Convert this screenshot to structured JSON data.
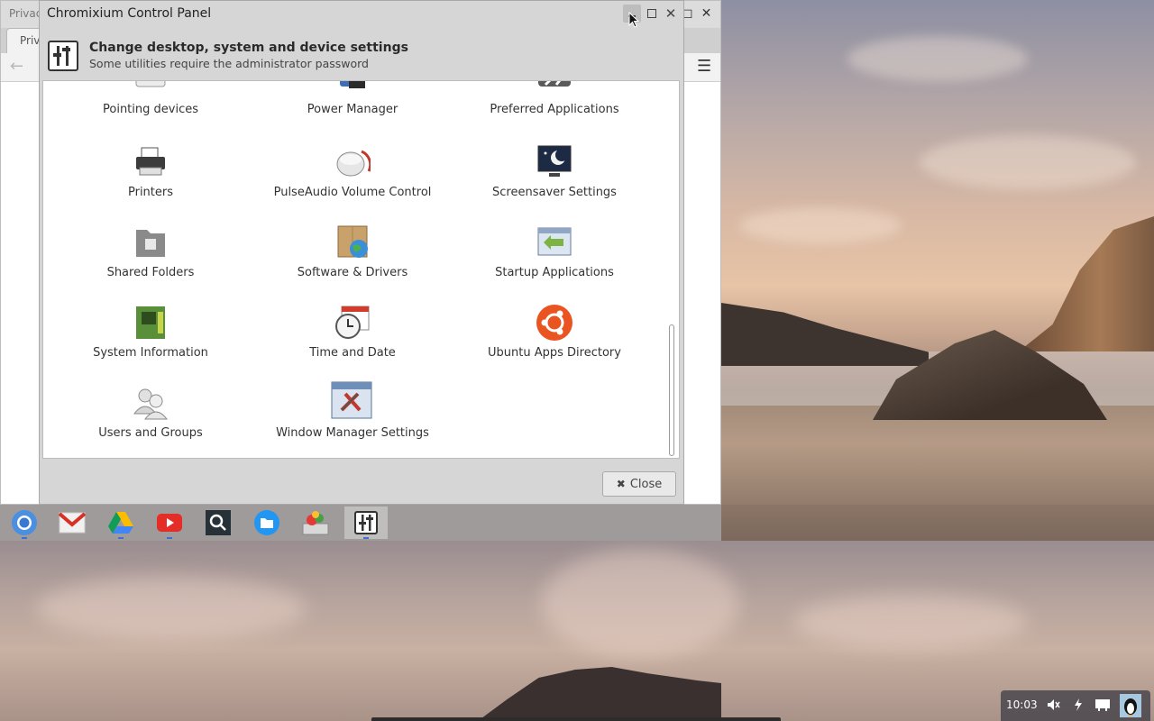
{
  "browser": {
    "top_text": "Privac",
    "tab_label": "Priv"
  },
  "window": {
    "title": "Chromixium Control Panel",
    "header_title": "Change desktop, system and device settings",
    "header_subtitle": "Some utilities require the administrator password",
    "close_button_label": "Close"
  },
  "items": [
    {
      "label": "Pointing devices",
      "icon": "mouse-icon"
    },
    {
      "label": "Power Manager",
      "icon": "battery-icon"
    },
    {
      "label": "Preferred Applications",
      "icon": "tools-icon"
    },
    {
      "label": "Printers",
      "icon": "printer-icon"
    },
    {
      "label": "PulseAudio Volume Control",
      "icon": "speaker-icon"
    },
    {
      "label": "Screensaver Settings",
      "icon": "monitor-moon-icon"
    },
    {
      "label": "Shared Folders",
      "icon": "shared-folder-icon"
    },
    {
      "label": "Software & Drivers",
      "icon": "package-globe-icon"
    },
    {
      "label": "Startup Applications",
      "icon": "startup-arrow-icon"
    },
    {
      "label": "System Information",
      "icon": "circuit-board-icon"
    },
    {
      "label": "Time and Date",
      "icon": "clock-calendar-icon"
    },
    {
      "label": "Ubuntu Apps Directory",
      "icon": "ubuntu-logo-icon"
    },
    {
      "label": "Users and Groups",
      "icon": "users-icon"
    },
    {
      "label": "Window Manager Settings",
      "icon": "window-tools-icon"
    }
  ],
  "shelf": [
    {
      "name": "chromium",
      "icon": "chromium-icon"
    },
    {
      "name": "gmail",
      "icon": "gmail-icon"
    },
    {
      "name": "google-drive",
      "icon": "drive-icon"
    },
    {
      "name": "youtube",
      "icon": "youtube-icon"
    },
    {
      "name": "search",
      "icon": "search-icon"
    },
    {
      "name": "files",
      "icon": "folder-icon"
    },
    {
      "name": "software",
      "icon": "software-center-icon"
    },
    {
      "name": "control-panel",
      "icon": "control-panel-icon"
    }
  ],
  "tray": {
    "time": "10:03"
  },
  "colors": {
    "accent": "#3b6fd8",
    "ubuntu_orange": "#e95420"
  }
}
